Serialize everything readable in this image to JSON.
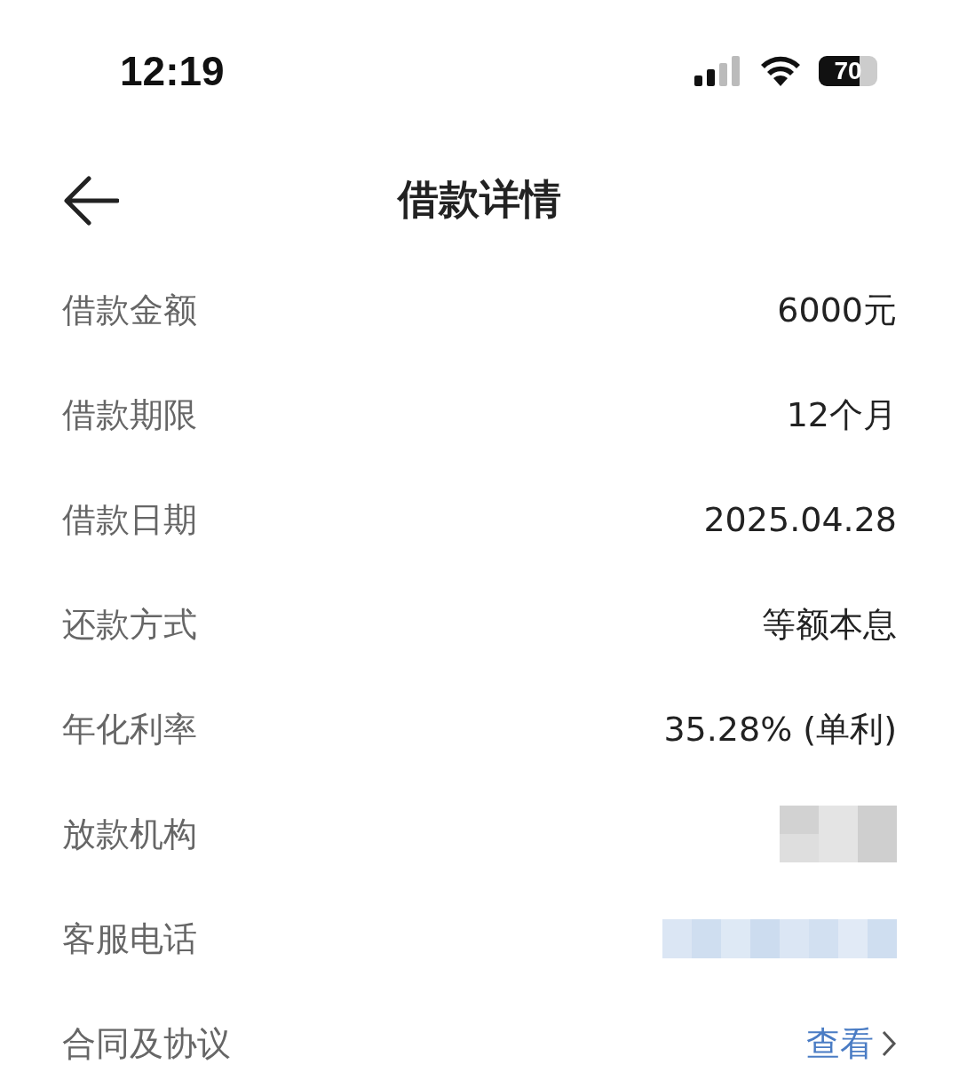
{
  "status_bar": {
    "time": "12:19",
    "battery": "70"
  },
  "nav": {
    "title": "借款详情"
  },
  "rows": [
    {
      "label": "借款金额",
      "kind": "text",
      "value": "6000元"
    },
    {
      "label": "借款期限",
      "kind": "text",
      "value": "12个月"
    },
    {
      "label": "借款日期",
      "kind": "text",
      "value": "2025.04.28"
    },
    {
      "label": "还款方式",
      "kind": "text",
      "value": "等额本息"
    },
    {
      "label": "年化利率",
      "kind": "text",
      "value": "35.28% (单利)"
    },
    {
      "label": "放款机构",
      "kind": "redacted"
    },
    {
      "label": "客服电话",
      "kind": "redacted_link"
    },
    {
      "label": "合同及协议",
      "kind": "link",
      "value": "查看"
    }
  ]
}
